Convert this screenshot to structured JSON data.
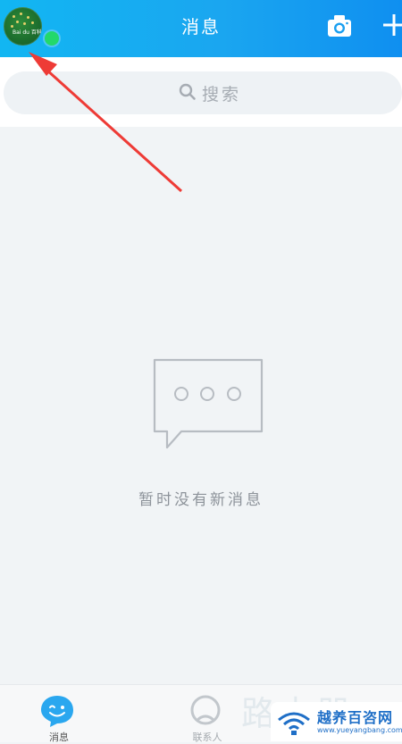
{
  "header": {
    "title": "消息",
    "avatar_text": "Bai du 百科",
    "colors": {
      "start": "#12b6f2",
      "end": "#0f8ff0",
      "online": "#23d86b"
    }
  },
  "search": {
    "label": "搜索"
  },
  "empty_state": {
    "message": "暂时没有新消息"
  },
  "annotation": {
    "arrow_color": "#ee3b36"
  },
  "tabbar": {
    "tabs": [
      {
        "label": "消息",
        "icon": "chat-bubble-face-icon",
        "selected": true
      },
      {
        "label": "联系人",
        "icon": "contacts-icon",
        "selected": false
      }
    ]
  },
  "watermark": {
    "text": "路由器",
    "badge_cn": "越养百咨网",
    "badge_url": "www.yueyangbang.com"
  }
}
